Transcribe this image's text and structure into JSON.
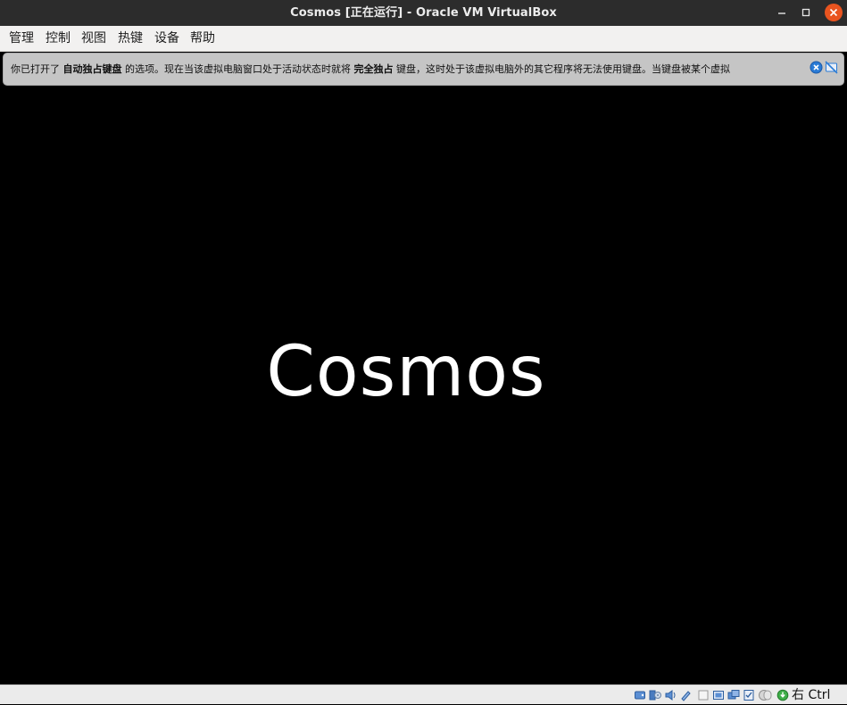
{
  "window": {
    "title": "Cosmos [正在运行] - Oracle VM VirtualBox"
  },
  "menu": {
    "items": [
      {
        "label": "管理"
      },
      {
        "label": "控制"
      },
      {
        "label": "视图"
      },
      {
        "label": "热键"
      },
      {
        "label": "设备"
      },
      {
        "label": "帮助"
      }
    ]
  },
  "notice": {
    "part1": "你已打开了 ",
    "bold1": "自动独占键盘",
    "part2": " 的选项。现在当该虚拟电脑窗口处于活动状态时就将 ",
    "bold2": "完全独占",
    "part3": " 键盘，这时处于该虚拟电脑外的其它程序将无法使用键盘。当键盘被某个虚拟"
  },
  "vm": {
    "boot_text": "Cosmos"
  },
  "statusbar": {
    "icons": [
      "hard-disk-icon",
      "optical-drive-icon",
      "audio-icon",
      "network-icon",
      "usb-icon",
      "shared-folders-icon",
      "display-icon",
      "recording-icon",
      "cpu-icon",
      "mouse-integration-icon",
      "keyboard-capture-icon"
    ],
    "host_key": "右 Ctrl"
  },
  "colors": {
    "titlebar": "#2c2c2c",
    "close_button": "#e9541f",
    "menubar": "#f2f1f0",
    "notice_bg": "#c5c5c5",
    "notice_close": "#2a7bd6",
    "screen": "#000000",
    "boot_text": "#ffffff"
  }
}
